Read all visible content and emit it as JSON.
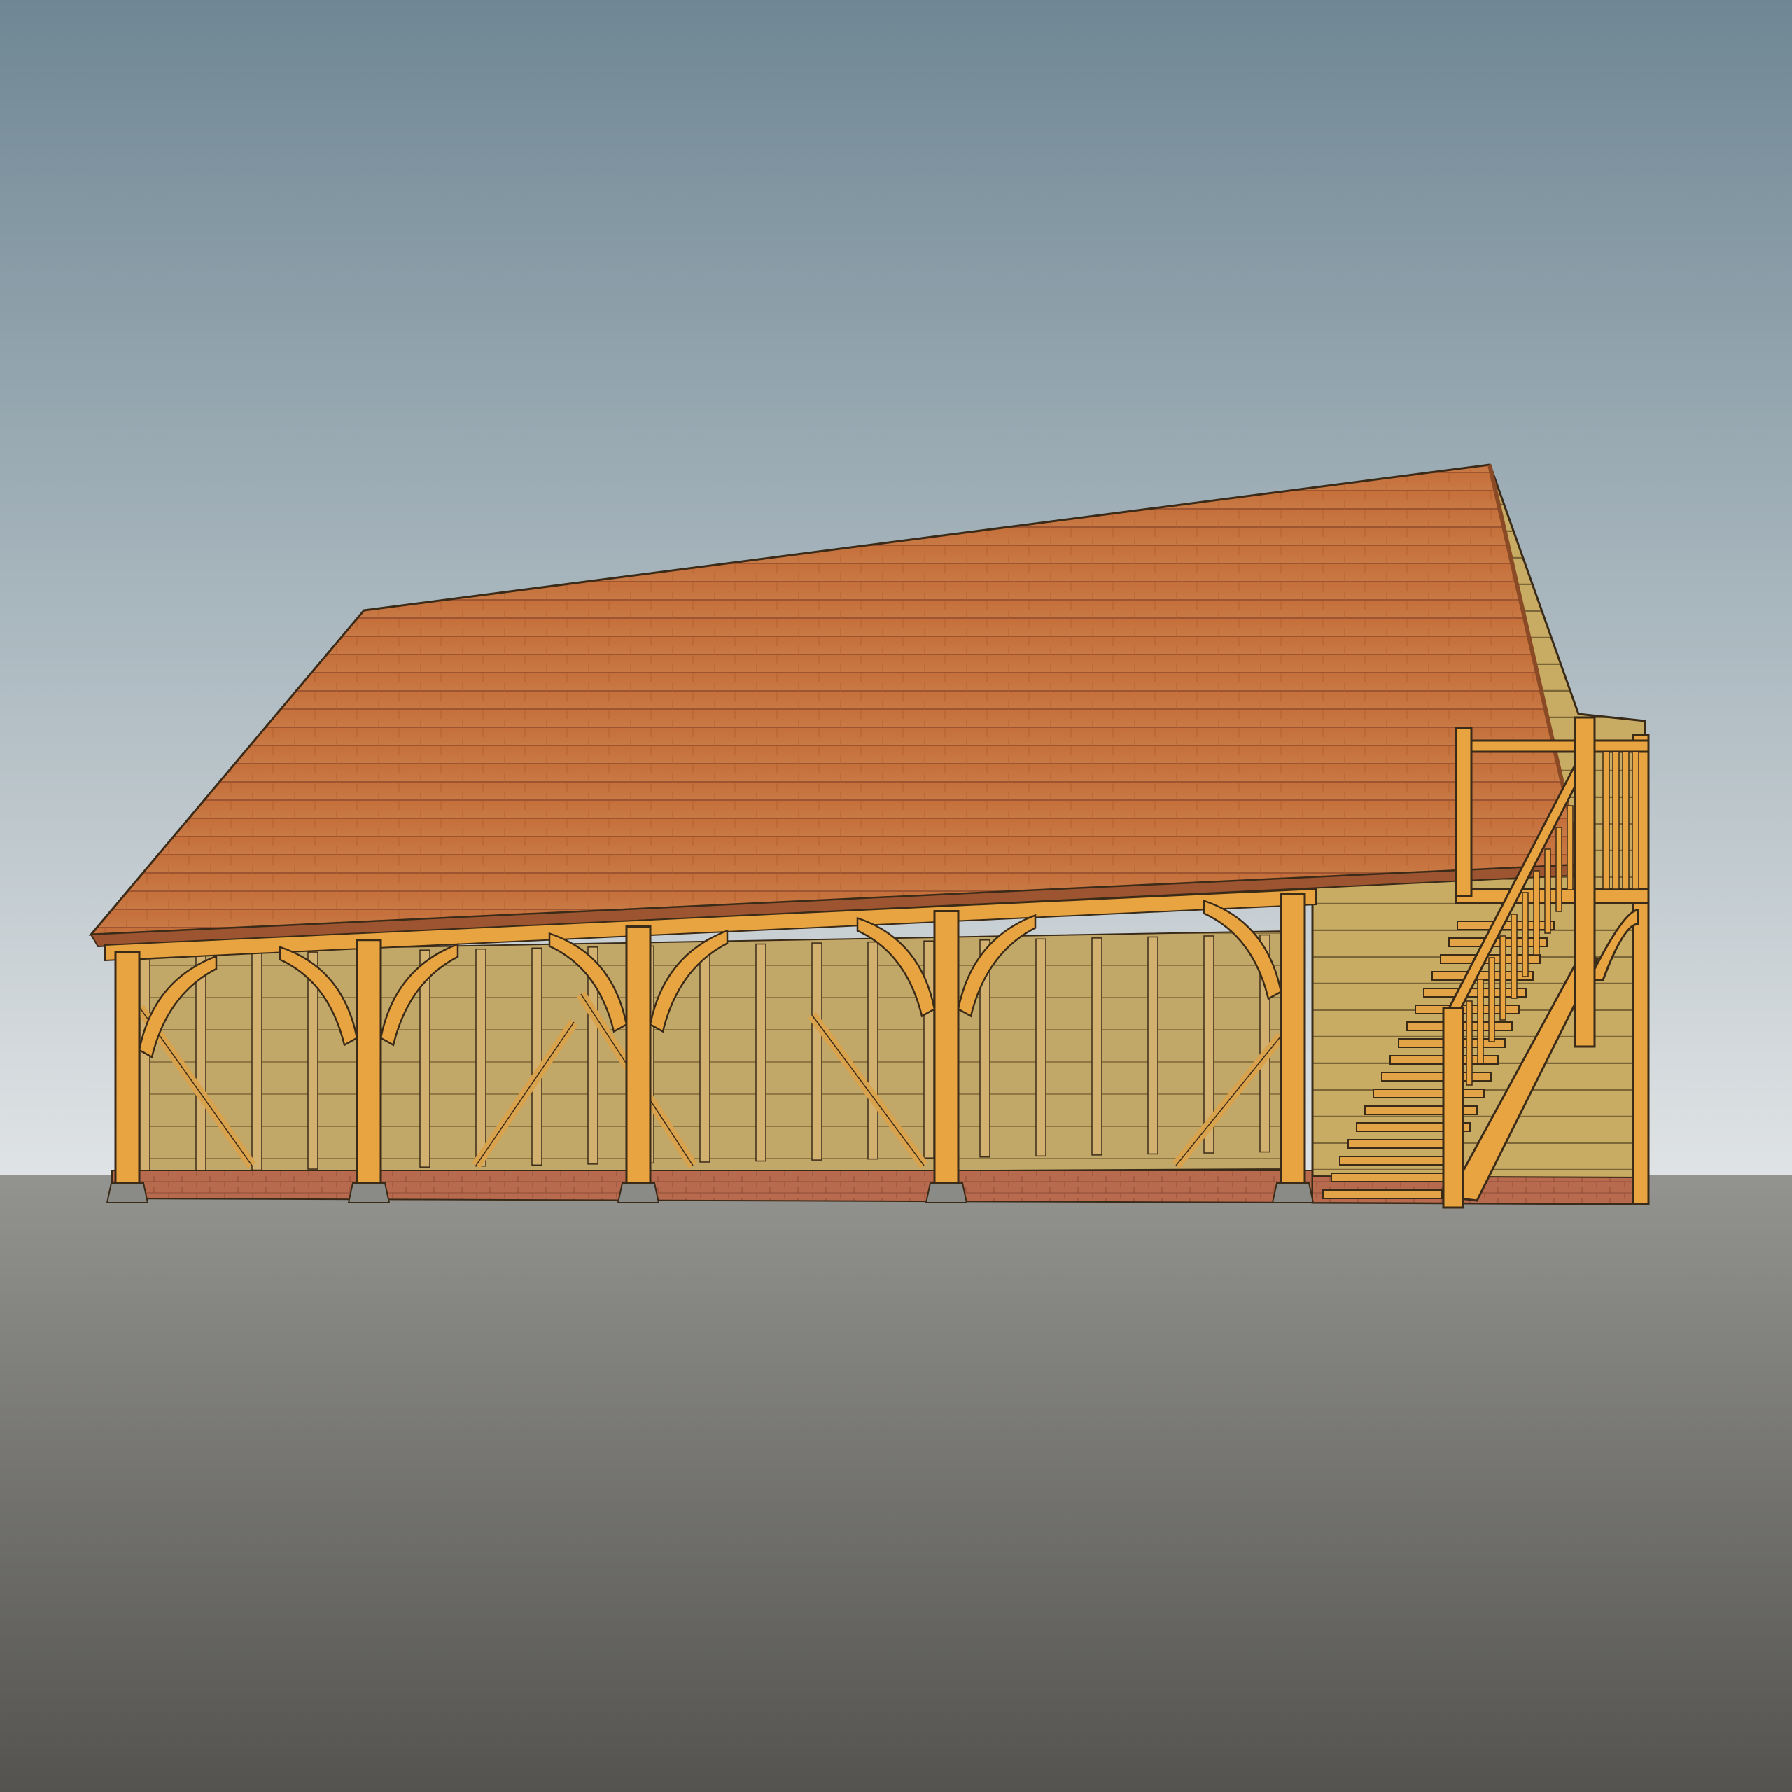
{
  "scene": {
    "type": "3d-model-render",
    "subject": "oak-frame-garage-with-room-above",
    "bays": 4,
    "elements": [
      "tiled-roof",
      "timber-posts",
      "curved-braces",
      "weatherboard-cladding",
      "external-staircase",
      "balcony",
      "gable-door",
      "brick-plinth",
      "padstones",
      "ground-plane",
      "sky"
    ]
  },
  "colors": {
    "sky_top": "#6f8794",
    "sky_bottom": "#dfe3e5",
    "ground_top": "#939390",
    "ground_bottom": "#545350",
    "roof": "#c2703d",
    "roof_dark": "#9c5530",
    "oak": "#e8a440",
    "oak_dark": "#b87a28",
    "cladding": "#c2a868",
    "cladding_dark": "#a88e52",
    "brick": "#b86a4e",
    "stone": "#8a8a86",
    "glass": "#5c6468",
    "outline": "#3a2a18"
  }
}
